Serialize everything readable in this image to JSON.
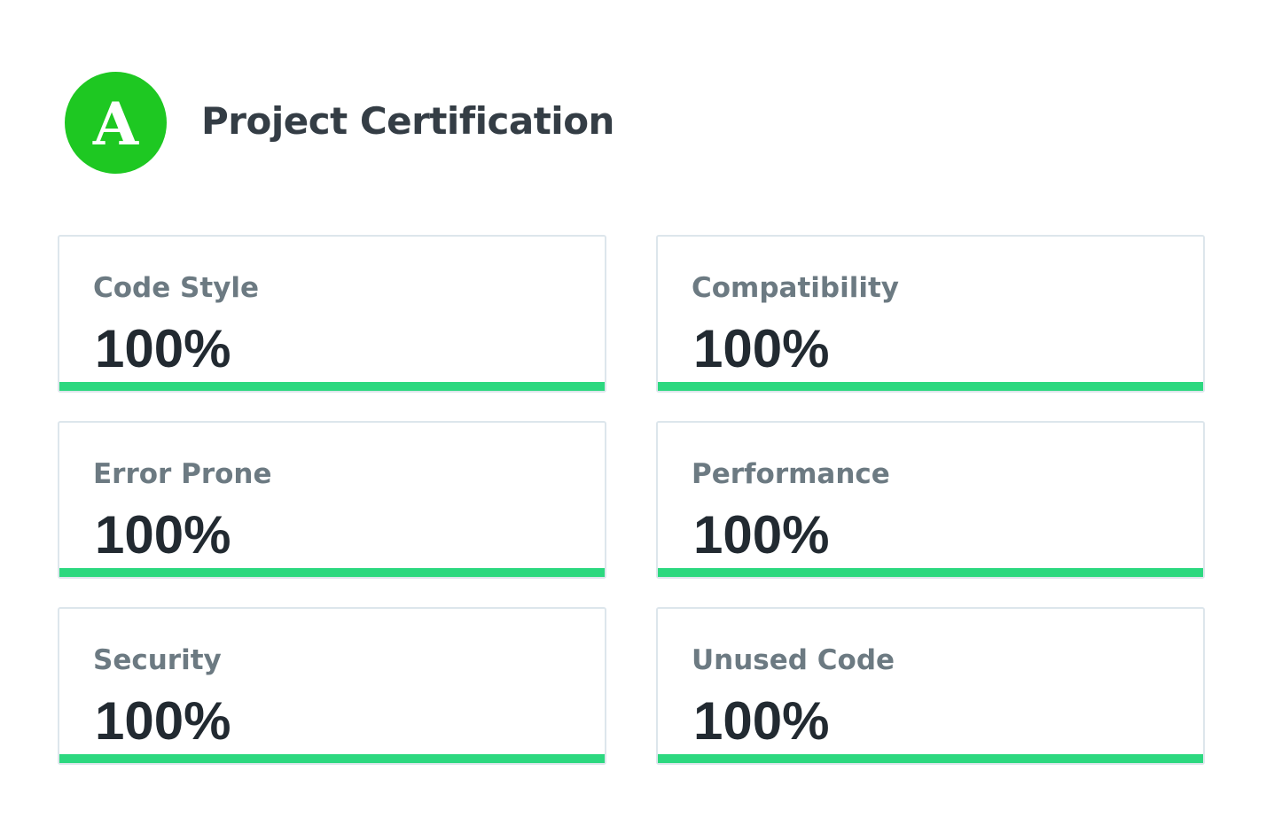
{
  "header": {
    "grade": "A",
    "title": "Project Certification",
    "grade_color": "#1ec822"
  },
  "accent_color": "#2cd87f",
  "metrics": [
    {
      "label": "Code Style",
      "value": "100%",
      "progress": 100
    },
    {
      "label": "Compatibility",
      "value": "100%",
      "progress": 100
    },
    {
      "label": "Error Prone",
      "value": "100%",
      "progress": 100
    },
    {
      "label": "Performance",
      "value": "100%",
      "progress": 100
    },
    {
      "label": "Security",
      "value": "100%",
      "progress": 100
    },
    {
      "label": "Unused Code",
      "value": "100%",
      "progress": 100
    }
  ]
}
